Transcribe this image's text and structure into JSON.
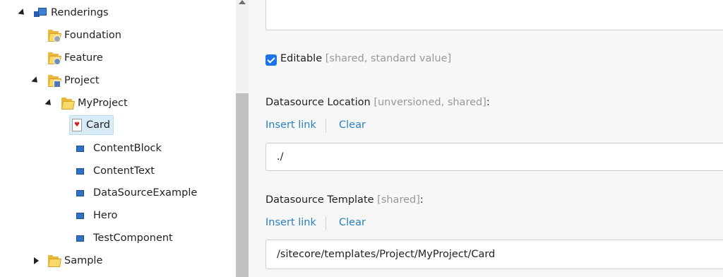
{
  "tree": {
    "renderings": "Renderings",
    "foundation": "Foundation",
    "feature": "Feature",
    "project": "Project",
    "myproject": "MyProject",
    "card": "Card",
    "children": [
      "ContentBlock",
      "ContentText",
      "DataSourceExample",
      "Hero",
      "TestComponent"
    ],
    "sample": "Sample"
  },
  "editor": {
    "top_field_value": "",
    "editable": {
      "checked": true,
      "label": "Editable",
      "meta": "[shared, standard value]"
    },
    "datasource_location": {
      "label": "Datasource Location",
      "meta": "[unversioned, shared]",
      "colon": ":",
      "insert_link": "Insert link",
      "clear": "Clear",
      "value": "./"
    },
    "datasource_template": {
      "label": "Datasource Template",
      "meta": "[shared]",
      "colon": ":",
      "insert_link": "Insert link",
      "clear": "Clear",
      "value": "/sitecore/templates/Project/MyProject/Card"
    }
  }
}
